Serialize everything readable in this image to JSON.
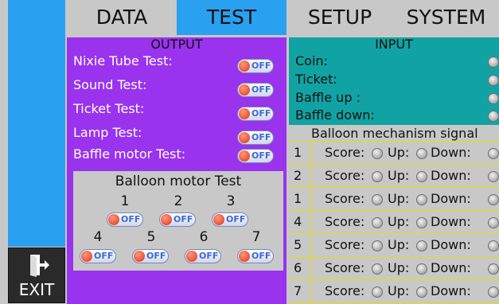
{
  "tabs": [
    {
      "label": "DATA",
      "active": false
    },
    {
      "label": "TEST",
      "active": true
    },
    {
      "label": "SETUP",
      "active": false
    },
    {
      "label": "SYSTEM",
      "active": false
    }
  ],
  "exit": {
    "label": "EXIT",
    "icon": "exit-door-icon"
  },
  "output": {
    "title": "OUTPUT",
    "items": [
      {
        "label": "Nixie Tube Test:",
        "state": "OFF"
      },
      {
        "label": "Sound Test:",
        "state": "OFF"
      },
      {
        "label": "Ticket Test:",
        "state": "OFF"
      },
      {
        "label": "Lamp Test:",
        "state": "OFF"
      },
      {
        "label": "Baffle motor Test:",
        "state": "OFF"
      }
    ]
  },
  "balloon_motor": {
    "title": "Balloon motor Test",
    "motors": [
      {
        "num": "1",
        "state": "OFF"
      },
      {
        "num": "2",
        "state": "OFF"
      },
      {
        "num": "3",
        "state": "OFF"
      },
      {
        "num": "4",
        "state": "OFF"
      },
      {
        "num": "5",
        "state": "OFF"
      },
      {
        "num": "6",
        "state": "OFF"
      },
      {
        "num": "7",
        "state": "OFF"
      }
    ]
  },
  "input": {
    "title": "INPUT",
    "items": [
      {
        "label": "Coin:"
      },
      {
        "label": "Ticket:"
      },
      {
        "label": "Baffle up :"
      },
      {
        "label": "Baffle down:"
      }
    ]
  },
  "signal": {
    "title": "Balloon mechanism signal",
    "score_label": "Score:",
    "up_label": "Up:",
    "down_label": "Down:",
    "rows": [
      "1",
      "2",
      "1",
      "4",
      "5",
      "6",
      "7"
    ]
  },
  "colors": {
    "tab_active": "#2aa0f0",
    "output_bg": "#9933ee",
    "input_bg": "#11a3a3",
    "toggle_text": "#3a6ad8",
    "row_line": "#e8e000"
  }
}
